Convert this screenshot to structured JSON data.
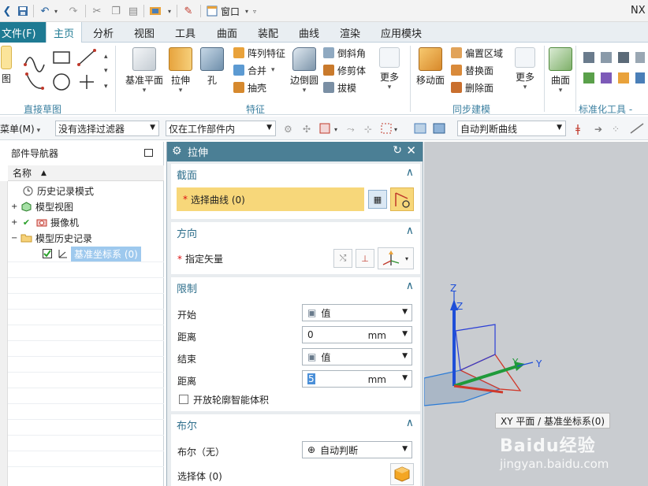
{
  "title_bar": {
    "window_menu": "窗口",
    "app_name": "NX"
  },
  "menu_tabs": {
    "file": "文件(F)",
    "tabs": [
      "主页",
      "分析",
      "视图",
      "工具",
      "曲面",
      "装配",
      "曲线",
      "渲染",
      "应用模块"
    ]
  },
  "ribbon": {
    "groups": {
      "sketch": "直接草图",
      "feature": "特征",
      "sync": "同步建模",
      "std": "标准化工具 - G..."
    },
    "buttons": {
      "datum_plane": "基准平面",
      "extrude": "拉伸",
      "hole": "孔",
      "edge_blend": "边倒圆",
      "more1": "更多",
      "move_face": "移动面",
      "more2": "更多",
      "surface": "曲面",
      "sketch_partial": "图"
    },
    "small_items": {
      "pattern": "阵列特征",
      "unite": "合并",
      "shell": "抽壳",
      "chamfer": "倒斜角",
      "trim_body": "修剪体",
      "draft": "拔模",
      "offset_region": "偏置区域",
      "replace_face": "替换面",
      "delete_face": "删除面"
    }
  },
  "filter_bar": {
    "menu": "菜单(M)",
    "selection_filter": "没有选择过滤器",
    "scope": "仅在工作部件内",
    "curve_rule": "自动判断曲线"
  },
  "navigator": {
    "title": "部件导航器",
    "column": "名称",
    "items": [
      {
        "label": "历史记录模式"
      },
      {
        "label": "模型视图"
      },
      {
        "label": "摄像机"
      },
      {
        "label": "模型历史记录"
      },
      {
        "label": "基准坐标系 (0)"
      }
    ]
  },
  "dialog": {
    "title": "拉伸",
    "section": {
      "title": "截面",
      "select_curve": "选择曲线 (0)"
    },
    "direction": {
      "title": "方向",
      "specify_vector": "指定矢量"
    },
    "limits": {
      "title": "限制",
      "start_label": "开始",
      "start_value": "值",
      "start_distance_label": "距离",
      "start_distance": "0",
      "end_label": "结束",
      "end_value": "值",
      "end_distance_label": "距离",
      "end_distance": "5",
      "unit": "mm",
      "open_profile": "开放轮廓智能体积"
    },
    "boolean": {
      "title": "布尔",
      "boolean_label": "布尔（无）",
      "boolean_value": "自动判断",
      "select_body": "选择体 (0)"
    }
  },
  "viewport": {
    "axis_z": "Z",
    "axis_z2": "Z",
    "axis_y": "Y",
    "axis_y2": "Y",
    "tooltip": "XY 平面 / 基准坐标系(0)"
  },
  "watermark": {
    "brand": "Baidu经验",
    "url": "jingyan.baidu.com"
  },
  "colors": {
    "accent": "#1e7a93",
    "dialog_title": "#4b7f95",
    "highlight": "#f7d77a",
    "axis_x": "#d0392b",
    "axis_y": "#1f9a3a",
    "axis_z": "#1f4fd8"
  }
}
